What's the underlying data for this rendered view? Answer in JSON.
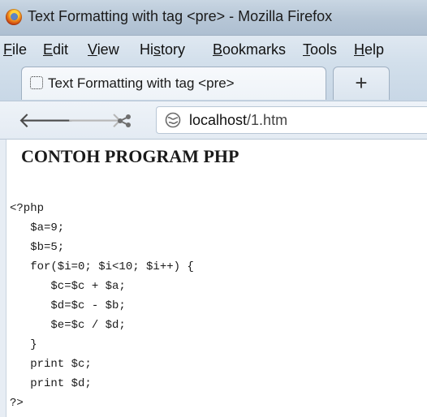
{
  "window": {
    "title": "Text Formatting with tag <pre> - Mozilla Firefox"
  },
  "menubar": {
    "items": [
      {
        "underline": "F",
        "rest": "ile"
      },
      {
        "underline": "E",
        "rest": "dit"
      },
      {
        "underline": "V",
        "rest": "iew"
      },
      {
        "pre": "Hi",
        "underline": "s",
        "rest": "tory"
      },
      {
        "underline": "B",
        "rest": "ookmarks"
      },
      {
        "underline": "T",
        "rest": "ools"
      },
      {
        "underline": "H",
        "rest": "elp"
      }
    ]
  },
  "tabs": {
    "active": {
      "label": "Text Formatting with tag <pre>"
    },
    "new_tab_symbol": "+"
  },
  "navbar": {
    "back_icon": "back-arrow-icon",
    "forward_icon": "forward-arrow-icon",
    "share_icon": "share-icon",
    "url_host": "localhost",
    "url_path": "/1.htm"
  },
  "page": {
    "heading": "CONTOH PROGRAM PHP",
    "code_lines": [
      "<?php",
      "   $a=9;",
      "   $b=5;",
      "   for($i=0; $i<10; $i++) {",
      "      $c=$c + $a;",
      "      $d=$c - $b;",
      "      $e=$c / $d;",
      "   }",
      "   print $c;",
      "   print $d;",
      "?>"
    ]
  },
  "colors": {
    "titlebar": "#b6c6d6",
    "menubar": "#d2dfeb",
    "text": "#1a1a1a"
  }
}
